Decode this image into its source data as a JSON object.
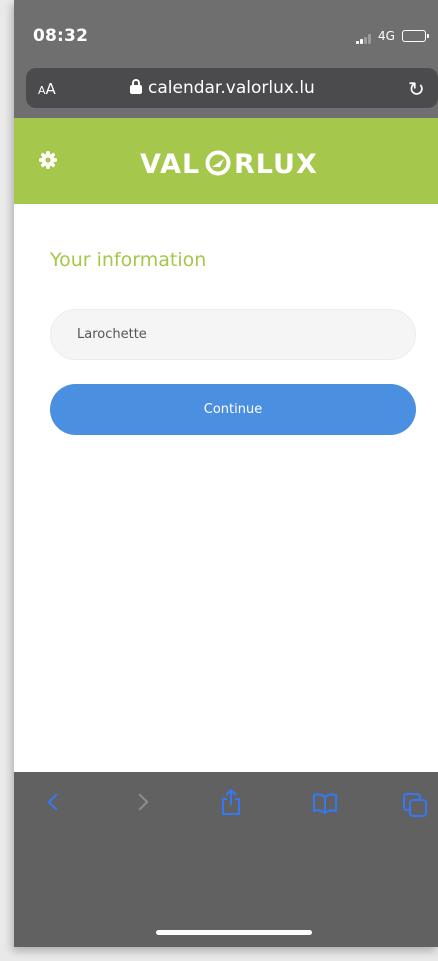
{
  "status_bar": {
    "time": "08:32",
    "network": "4G",
    "battery_level": 1.0
  },
  "address_bar": {
    "text_size_label": "AA",
    "url": "calendar.valorlux.lu"
  },
  "site": {
    "logo_text": "VALORLUX",
    "brand_color": "#a5c74b"
  },
  "form": {
    "title": "Your information",
    "name_value": "Larochette",
    "name_placeholder": "",
    "continue_label": "Continue",
    "button_color": "#4a8fe0"
  },
  "toolbar": {
    "icons": [
      "back-icon",
      "forward-icon",
      "share-icon",
      "bookmarks-icon",
      "tabs-icon"
    ],
    "accent": "#3478f6"
  }
}
